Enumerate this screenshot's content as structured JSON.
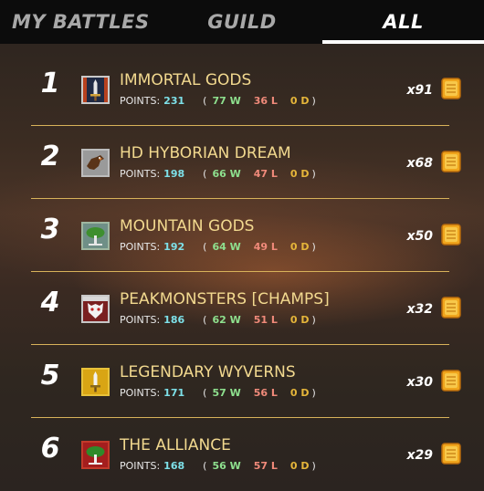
{
  "tabs": [
    {
      "label": "MY BATTLES"
    },
    {
      "label": "GUILD"
    },
    {
      "label": "ALL"
    }
  ],
  "leaderboard": [
    {
      "rank": "1",
      "name": "IMMORTAL GODS",
      "points_label": "POINTS:",
      "points": "231",
      "wins": "77 W",
      "losses": "36 L",
      "draws": "0 D",
      "multiplier": "x91",
      "banner_icon": "sword-banner-icon"
    },
    {
      "rank": "2",
      "name": "HD HYBORIAN DREAM",
      "points_label": "POINTS:",
      "points": "198",
      "wins": "66 W",
      "losses": "47 L",
      "draws": "0 D",
      "multiplier": "x68",
      "banner_icon": "beast-banner-icon"
    },
    {
      "rank": "3",
      "name": "MOUNTAIN GODS",
      "points_label": "POINTS:",
      "points": "192",
      "wins": "64 W",
      "losses": "49 L",
      "draws": "0 D",
      "multiplier": "x50",
      "banner_icon": "tree-banner-icon"
    },
    {
      "rank": "4",
      "name": "PEAKMONSTERS [CHAMPS]",
      "points_label": "POINTS:",
      "points": "186",
      "wins": "62 W",
      "losses": "51 L",
      "draws": "0 D",
      "multiplier": "x32",
      "banner_icon": "monster-banner-icon"
    },
    {
      "rank": "5",
      "name": "LEGENDARY WYVERNS",
      "points_label": "POINTS:",
      "points": "171",
      "wins": "57 W",
      "losses": "56 L",
      "draws": "0 D",
      "multiplier": "x30",
      "banner_icon": "sword-banner-icon"
    },
    {
      "rank": "6",
      "name": "THE ALLIANCE",
      "points_label": "POINTS:",
      "points": "168",
      "wins": "56 W",
      "losses": "57 L",
      "draws": "0 D",
      "multiplier": "x29",
      "banner_icon": "tree-banner-icon"
    }
  ],
  "colors": {
    "name": "#f2d98f",
    "points": "#7de0e8",
    "wins": "#8ee08e",
    "losses": "#f08a7a",
    "draws": "#e6b63a",
    "separator": "#d8b25a"
  }
}
